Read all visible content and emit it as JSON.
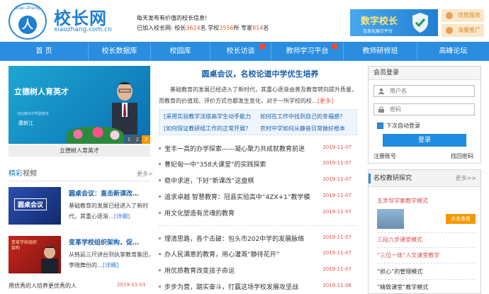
{
  "header": {
    "logo_arc": "Xiao Zhang",
    "logo_char": "人",
    "site_name": "校长网",
    "site_url": "xiaozhang.com.cn",
    "slogan": "每天发布有价值的校长信息!",
    "stats_prefix": "已加入校长网:",
    "stats_principal_label": "校长",
    "stats_principal_num": "3624",
    "stats_principal_unit": "名",
    "stats_school_label": "学校",
    "stats_school_num": "3556",
    "stats_school_unit": "所",
    "stats_expert_label": "专家",
    "stats_expert_num": "814",
    "stats_expert_unit": "名",
    "ad_title": "数字校长",
    "ad_sub": "信息化展示平台",
    "badge1": "优势服务",
    "badge2": "海量推广"
  },
  "nav": {
    "items": [
      "首 页",
      "校长数据库",
      "校园库",
      "校长访谈",
      "教师学习平台",
      "教师研修班",
      "高峰论坛"
    ]
  },
  "hero": {
    "title": "立德树人育英才",
    "sub": "河北衡水中学副校长",
    "name": "康新江",
    "pager": [
      "1",
      "2",
      "3"
    ],
    "caption": "立德树人育英才"
  },
  "video": {
    "title_a": "精彩",
    "title_b": "视频",
    "more": "更多>",
    "items": [
      {
        "thumb_text": "圆桌会议",
        "title": "圆桌会议：直击新课改…",
        "desc": "基础教育的发展已经进入了新时代，其重心逐渐…",
        "detail": "[详细]"
      },
      {
        "thumb_text": "变革学校组织架构",
        "title": "变革学校组织架构，促…",
        "desc": "从韩延三尺讲台到执掌教育集团，李晓舞份的…",
        "detail": "[详细]"
      }
    ],
    "last_title": "用优秀的人培养更优秀的人",
    "last_date": "2019-11-01"
  },
  "featured": {
    "title": "圆桌会议，名校论道中学优生培养",
    "desc": "基础教育的发展已经进入了新时代，其重心逐渐由普及教育转向提升质量，而教育的价值观、评价方式也都发生变化，对于一所学校的校…",
    "more": "[更多]",
    "links": [
      "[采用实验教学法搭高学生动手能力",
      "如何在工作中找到自己的幸福感?",
      "[如何保证教研组工作的正常开展?",
      "农村中学如何从静音日常做好根本"
    ]
  },
  "news": [
    {
      "title": "宝丰一高的办学探索——凝心聚力共成就教育前进",
      "date": "2019-11-07"
    },
    {
      "title": "曹妃甸一中“358大课堂”的实践探索",
      "date": "2019-11-07"
    },
    {
      "title": "稳中求进，下好“新课改”这盘棋",
      "date": "2019-11-07"
    },
    {
      "title": "追求卓越 智慧教育：冠县实验高中“4ZX+1”教学模",
      "date": "2019-11-07"
    },
    {
      "title": "用文化塑造有灵魂的教育",
      "date": "2019-11-07"
    },
    {
      "title": "理清思路，各个击破：包头市202中学的发展脉络",
      "date": "2019-11-07"
    },
    {
      "title": "办人民满意的教育，用心灌溉“静待花开”",
      "date": "2019-11-07"
    },
    {
      "title": "用优质教育改变孩子命运",
      "date": "2019-11-07"
    },
    {
      "title": "步步为营，踏实奋斗，打赢这场学校发展攻坚战",
      "date": "2019-11-06"
    }
  ],
  "login": {
    "title": "会员登录",
    "username_placeholder": "用户名",
    "password_placeholder": "密码",
    "remember": "下次自动登录",
    "button": "登录",
    "register": "注册账号",
    "forgot": "找回密码"
  },
  "research": {
    "title": "名校教研探究",
    "more": "更多>>",
    "item1": "五步导学案教学模式",
    "button": "点击查看",
    "items": [
      "三段六步课堂模式",
      "“三位一体”人文课堂教学",
      "“抓心”的管理模式",
      "“精致课堂”教学模式"
    ]
  },
  "colors": {
    "brand": "#2a8de0",
    "date": "#d9534f",
    "link": "#1a5fa8",
    "accent": "#f39800"
  }
}
